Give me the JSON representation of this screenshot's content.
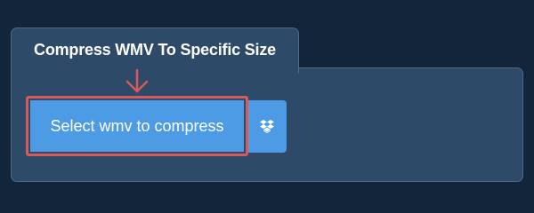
{
  "card": {
    "title": "Compress WMV To Specific Size"
  },
  "upload": {
    "select_label": "Select wmv to compress",
    "dropbox_icon": "dropbox-icon"
  },
  "annotation": {
    "arrow_icon": "arrow-down-icon",
    "highlight_color": "#d9595a"
  },
  "colors": {
    "background": "#13253a",
    "panel": "#2e4a69",
    "button": "#4d9be5",
    "text": "#ffffff"
  }
}
